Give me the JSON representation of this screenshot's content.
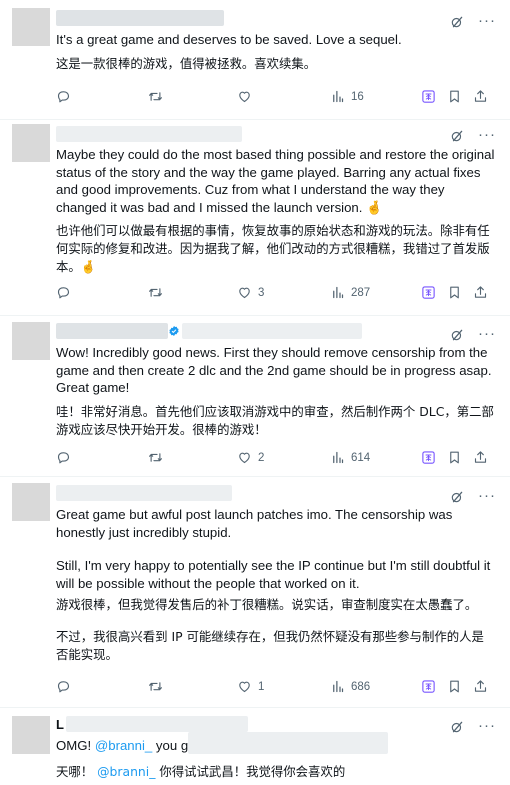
{
  "tweets": [
    {
      "text_en": "It's a great game and deserves to be saved. Love a sequel.",
      "text_zh": "这是一款很棒的游戏，值得被拯救。喜欢续集。",
      "likes": "",
      "views": "16"
    },
    {
      "text_en": "Maybe they could do the most based thing possible and restore the original status of the story and the way the game played. Barring any actual fixes and good improvements. Cuz from what I understand the way they changed it was bad and I missed the launch version. 🤞",
      "text_zh": "也许他们可以做最有根据的事情，恢复故事的原始状态和游戏的玩法。除非有任何实际的修复和改进。因为据我了解，他们改动的方式很糟糕，我错过了首发版本。🤞",
      "likes": "3",
      "views": "287"
    },
    {
      "text_en": "Wow! Incredibly good news. First they should remove censorship from the game and then create 2 dlc and the 2nd game should be in progress asap. Great game!",
      "text_zh": "哇！非常好消息。首先他们应该取消游戏中的审查，然后制作两个 DLC，第二部游戏应该尽快开始开发。很棒的游戏！",
      "likes": "2",
      "views": "614"
    },
    {
      "text_en_1": "Great game but awful post launch patches imo. The censorship was honestly just incredibly stupid.",
      "text_en_2": "Still, I'm very happy to potentially see the IP continue but I'm still doubtful it will be possible without the people that worked on it.",
      "text_zh_1": "游戏很棒，但我觉得发售后的补丁很糟糕。说实话，审查制度实在太愚蠢了。",
      "text_zh_2": "不过，我很高兴看到 IP 可能继续存在，但我仍然怀疑没有那些参与制作的人是否能实现。",
      "likes": "1",
      "views": "686"
    },
    {
      "name_initial": "L",
      "en_prefix": "OMG! ",
      "en_mention": "@branni_",
      "en_suffix": " you go",
      "zh_prefix": "天哪！ ",
      "zh_mention": "@branni_",
      "zh_suffix": " 你得试试武昌！我觉得你会喜欢的"
    }
  ],
  "icons": {
    "reply": "reply-icon",
    "retweet": "retweet-icon",
    "like": "like-icon",
    "views": "views-icon",
    "translate": "translate-icon",
    "bookmark": "bookmark-icon",
    "share": "share-icon",
    "grok": "grok-icon",
    "more": "more-icon"
  },
  "colors": {
    "icon": "#536471",
    "link": "#1d9bf0",
    "translate": "#7856ff",
    "text": "#0f1419",
    "separator": "#eff3f4"
  }
}
